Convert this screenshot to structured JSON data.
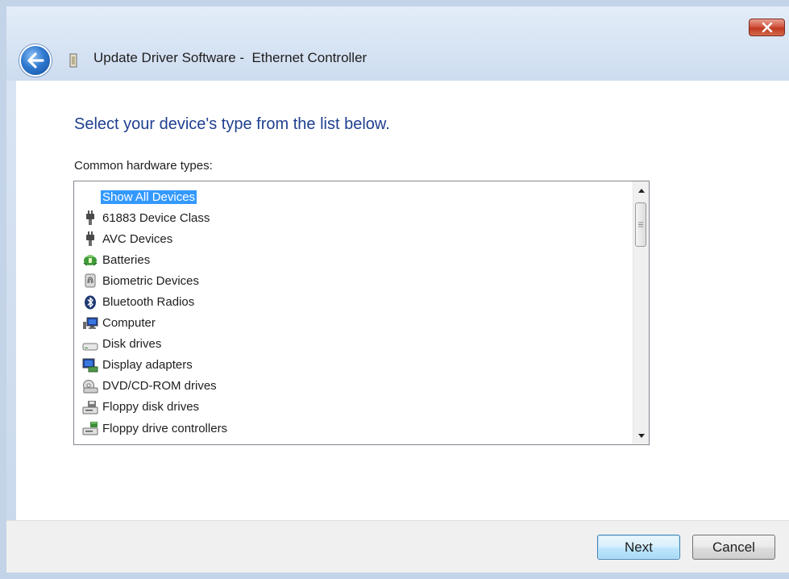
{
  "window": {
    "title": "Update Driver Software -  Ethernet Controller",
    "close_label": "x"
  },
  "main": {
    "heading": "Select your device's type from the list below.",
    "list_label": "Common hardware types:"
  },
  "hardware_list": {
    "selected": "Show All Devices",
    "items": [
      {
        "label": "Show All Devices",
        "icon": "none"
      },
      {
        "label": "61883 Device Class",
        "icon": "plug-icon"
      },
      {
        "label": "AVC Devices",
        "icon": "plug-icon"
      },
      {
        "label": "Batteries",
        "icon": "battery-icon"
      },
      {
        "label": "Biometric Devices",
        "icon": "fingerprint-icon"
      },
      {
        "label": "Bluetooth Radios",
        "icon": "bluetooth-icon"
      },
      {
        "label": "Computer",
        "icon": "computer-icon"
      },
      {
        "label": "Disk drives",
        "icon": "disk-drive-icon"
      },
      {
        "label": "Display adapters",
        "icon": "display-adapter-icon"
      },
      {
        "label": "DVD/CD-ROM drives",
        "icon": "dvd-drive-icon"
      },
      {
        "label": "Floppy disk drives",
        "icon": "floppy-drive-icon"
      },
      {
        "label": "Floppy drive controllers",
        "icon": "floppy-controller-icon"
      }
    ]
  },
  "footer": {
    "next_label": "Next",
    "cancel_label": "Cancel"
  },
  "colors": {
    "heading": "#1f3f90",
    "selection": "#3399ff",
    "frame": "#c3d3e8"
  }
}
